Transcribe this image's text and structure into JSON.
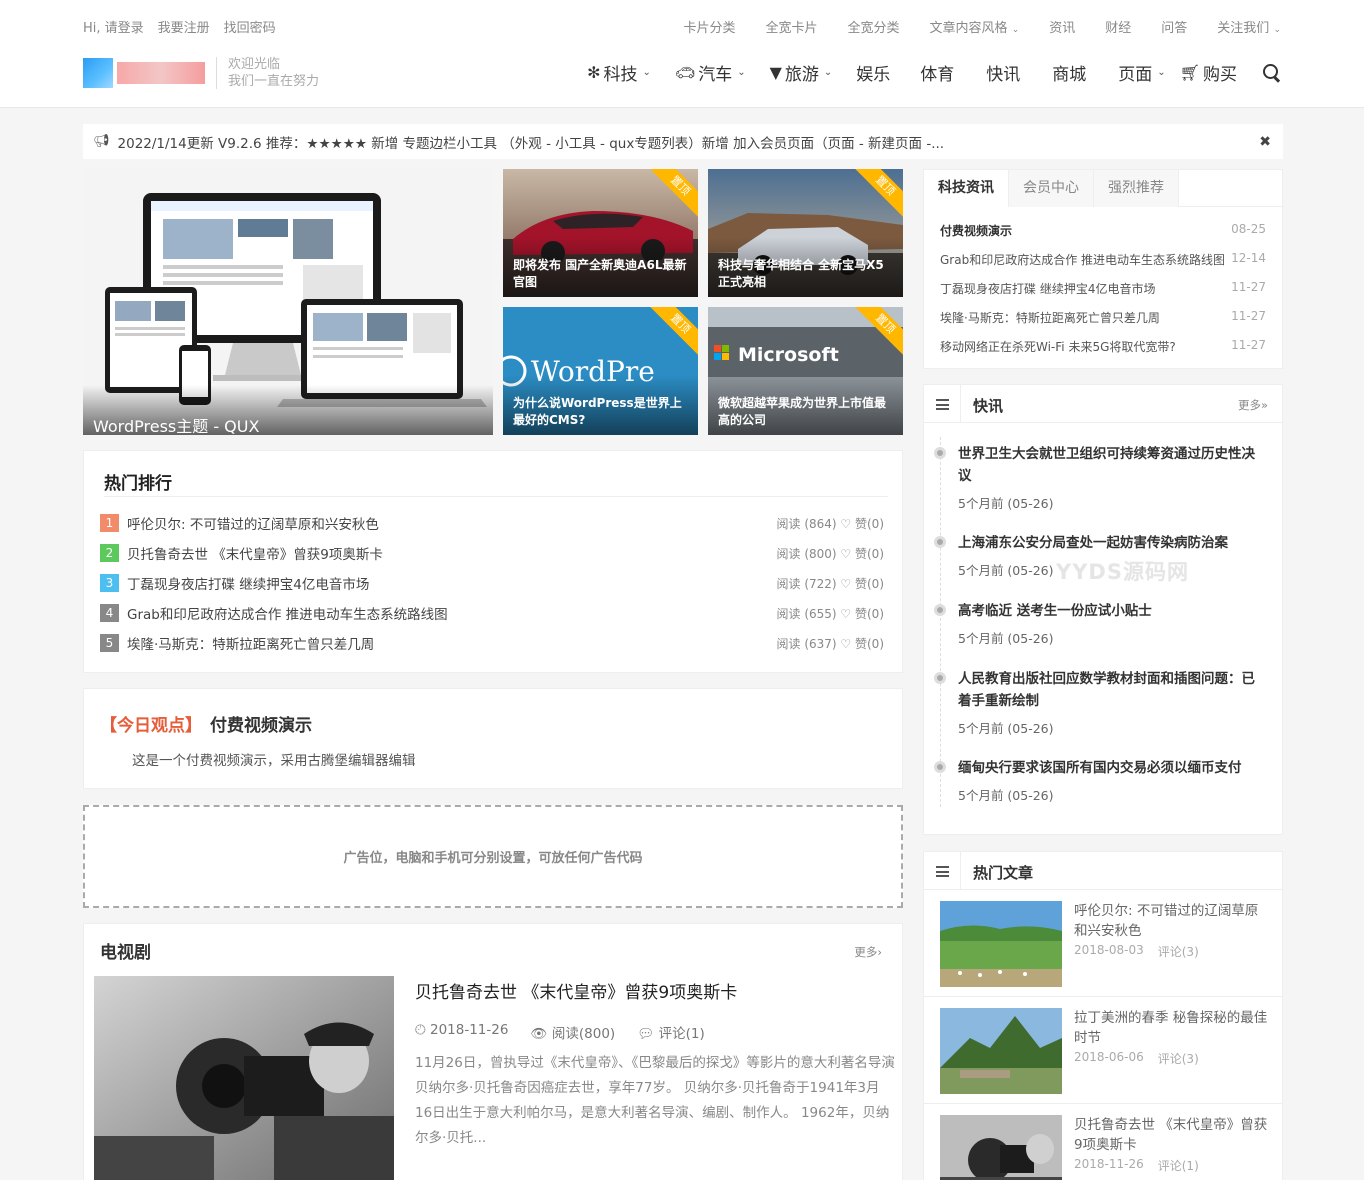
{
  "header": {
    "top_left_links": [
      "Hi, 请登录",
      "我要注册",
      "找回密码"
    ],
    "top_right_links": [
      "卡片分类",
      "全宽卡片",
      "全宽分类",
      "文章内容风格",
      "资讯",
      "财经",
      "问答",
      "关注我们"
    ],
    "welcome_line1": "欢迎光临",
    "welcome_line2": "我们一直在努力",
    "nav": [
      {
        "label": "科技",
        "icon": "yelp-icon",
        "dropdown": true
      },
      {
        "label": "汽车",
        "icon": "car-icon",
        "dropdown": true
      },
      {
        "label": "旅游",
        "icon": "filter-icon",
        "dropdown": true
      },
      {
        "label": "娱乐",
        "icon": "",
        "dropdown": false
      },
      {
        "label": "体育",
        "icon": "",
        "dropdown": false
      },
      {
        "label": "快讯",
        "icon": "",
        "dropdown": false
      },
      {
        "label": "商城",
        "icon": "",
        "dropdown": false
      },
      {
        "label": "页面",
        "icon": "",
        "dropdown": true
      },
      {
        "label": "购买",
        "icon": "cart-icon",
        "dropdown": false
      }
    ]
  },
  "notice": {
    "text": "2022/1/14更新 V9.2.6 推荐：★★★★★ 新增 专题边栏小工具 （外观 - 小工具 - qux专题列表）新增 加入会员页面（页面 - 新建页面 -..."
  },
  "slider": {
    "main_caption": "WordPress主题 - QUX",
    "thumbs": [
      {
        "caption": "即将发布 国产全新奥迪A6L最新官图",
        "ribbon": "置顶"
      },
      {
        "caption": "科技与奢华相结合 全新宝马X5正式亮相",
        "ribbon": "置顶"
      },
      {
        "caption": "为什么说WordPress是世界上最好的CMS?",
        "ribbon": "置顶",
        "bg_text": "WordPre"
      },
      {
        "caption": "微软超越苹果成为世界上市值最高的公司",
        "ribbon": "置顶",
        "bg_text": "Microsoft"
      }
    ]
  },
  "hot_rank": {
    "title": "热门排行",
    "items": [
      {
        "num": "1",
        "color": "#f28b6a",
        "title": "呼伦贝尔: 不可错过的辽阔草原和兴安秋色",
        "meta": "阅读 (864)  ♡ 赞(0)"
      },
      {
        "num": "2",
        "color": "#5cc95c",
        "title": "贝托鲁奇去世 《末代皇帝》曾获9项奥斯卡",
        "meta": "阅读 (800)  ♡ 赞(0)"
      },
      {
        "num": "3",
        "color": "#4dbef0",
        "title": "丁磊现身夜店打碟 继续押宝4亿电音市场",
        "meta": "阅读 (722)  ♡ 赞(0)"
      },
      {
        "num": "4",
        "color": "#888888",
        "title": "Grab和印尼政府达成合作 推进电动车生态系统路线图",
        "meta": "阅读 (655)  ♡ 赞(0)"
      },
      {
        "num": "5",
        "color": "#888888",
        "title": "埃隆·马斯克：特斯拉距离死亡曾只差几周",
        "meta": "阅读 (637)  ♡ 赞(0)"
      }
    ]
  },
  "today_view": {
    "tag": "【今日观点】",
    "title": "付费视频演示",
    "desc": "这是一个付费视频演示，采用古腾堡编辑器编辑"
  },
  "ad": {
    "text": "广告位，电脑和手机可分别设置，可放任何广告代码"
  },
  "tv": {
    "title": "电视剧",
    "more": "更多›",
    "post_title": "贝托鲁奇去世 《末代皇帝》曾获9项奥斯卡",
    "date": "2018-11-26",
    "reads": "阅读(800)",
    "comments": "评论(1)",
    "excerpt": "11月26日，曾执导过《末代皇帝》、《巴黎最后的探戈》等影片的意大利著名导演贝纳尔多·贝托鲁奇因癌症去世，享年77岁。 贝纳尔多·贝托鲁奇于1941年3月16日出生于意大利帕尔马，是意大利著名导演、编剧、制作人。 1962年，贝纳尔多·贝托..."
  },
  "sidebar_tabs": {
    "tabs": [
      "科技资讯",
      "会员中心",
      "强烈推荐"
    ],
    "active": 0,
    "items": [
      {
        "title": "付费视频演示",
        "date": "08-25",
        "bold": true
      },
      {
        "title": "Grab和印尼政府达成合作 推进电动车生态系统路线图",
        "date": "12-14"
      },
      {
        "title": "丁磊现身夜店打碟 继续押宝4亿电音市场",
        "date": "11-27"
      },
      {
        "title": "埃隆·马斯克：特斯拉距离死亡曾只差几周",
        "date": "11-27"
      },
      {
        "title": "移动网络正在杀死Wi-Fi 未来5G将取代宽带?",
        "date": "11-27"
      }
    ]
  },
  "flash": {
    "title": "快讯",
    "more": "更多»",
    "items": [
      {
        "title": "世界卫生大会就世卫组织可持续筹资通过历史性决议",
        "time": "5个月前 (05-26)"
      },
      {
        "title": "上海浦东公安分局查处一起妨害传染病防治案",
        "time": "5个月前 (05-26)"
      },
      {
        "title": "高考临近 送考生一份应试小贴士",
        "time": "5个月前 (05-26)"
      },
      {
        "title": "人民教育出版社回应数学教材封面和插图问题：已着手重新绘制",
        "time": "5个月前 (05-26)"
      },
      {
        "title": "缅甸央行要求该国所有国内交易必须以缅币支付",
        "time": "5个月前 (05-26)"
      }
    ]
  },
  "watermark": "YYDS源码网",
  "hot_posts": {
    "title": "热门文章",
    "items": [
      {
        "title": "呼伦贝尔: 不可错过的辽阔草原和兴安秋色",
        "date": "2018-08-03",
        "comments": "评论(3)"
      },
      {
        "title": "拉丁美洲的春季 秘鲁探秘的最佳时节",
        "date": "2018-06-06",
        "comments": "评论(3)"
      },
      {
        "title": "贝托鲁奇去世 《末代皇帝》曾获9项奥斯卡",
        "date": "2018-11-26",
        "comments": "评论(1)"
      }
    ]
  }
}
